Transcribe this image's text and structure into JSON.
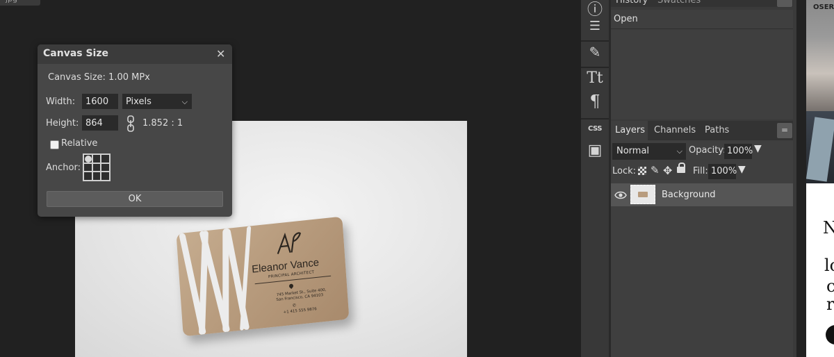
{
  "document": {
    "tab_label": "jpg"
  },
  "dialog": {
    "title": "Canvas Size",
    "close_glyph": "✕",
    "size_info": "Canvas Size: 1.00 MPx",
    "width_label": "Width:",
    "width_value": "1600",
    "unit": "Pixels",
    "height_label": "Height:",
    "height_value": "864",
    "ratio": "1.852 : 1",
    "relative_label": "Relative",
    "relative_checked": false,
    "anchor_label": "Anchor:",
    "ok_label": "OK"
  },
  "card": {
    "name": "Eleanor Vance",
    "role": "PRINCIPAL ARCHITECT",
    "address_line1": "745 Market St., Suite 400,",
    "address_line2": "San Francisco, CA 94103",
    "phone": "+1 415 555 9876"
  },
  "toolbar": {
    "info_glyph": "ⓘ",
    "adjust_glyph": "☰",
    "brush_glyph": "✎",
    "type_glyph": "Tt",
    "paragraph_glyph": "¶",
    "css_label": "CSS",
    "image_glyph": "▣"
  },
  "history_panel": {
    "tabs": [
      "History",
      "Swatches"
    ],
    "items": [
      "Open"
    ],
    "menu_glyph": "="
  },
  "layers_panel": {
    "tabs": [
      "Layers",
      "Channels",
      "Paths"
    ],
    "active_tab": "Layers",
    "menu_glyph": "=",
    "blend_mode": "Normal",
    "opacity_label": "Opacity:",
    "opacity_value": "100%",
    "lock_label": "Lock:",
    "fill_label": "Fill:",
    "fill_value": "100%",
    "layers": [
      {
        "name": "Background",
        "visible": true
      }
    ]
  },
  "photo_strip": {
    "label": "OSERS",
    "letters": [
      "N",
      "lo",
      "c",
      "r"
    ]
  }
}
